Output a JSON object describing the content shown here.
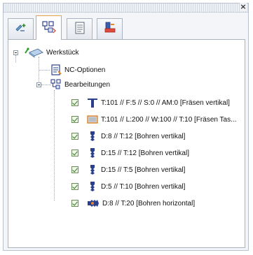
{
  "tree": {
    "root": {
      "label": "Werkstück"
    },
    "nc_options": {
      "label": "NC-Optionen"
    },
    "operations_group": {
      "label": "Bearbeitungen"
    },
    "operations": [
      {
        "label": "T:101 // F:5 // S:0 // AM:0 [Fräsen vertikal]",
        "icon": "milling-tool-icon"
      },
      {
        "label": "T:101 // L:200 // W:100 // T:10 [Fräsen Tas...",
        "icon": "pocket-milling-icon"
      },
      {
        "label": "D:8 // T:12 [Bohren vertikal]",
        "icon": "drill-vertical-icon"
      },
      {
        "label": "D:15 // T:12 [Bohren vertikal]",
        "icon": "drill-vertical-icon"
      },
      {
        "label": "D:15 // T:5 [Bohren vertikal]",
        "icon": "drill-vertical-icon"
      },
      {
        "label": "D:5 // T:10 [Bohren vertikal]",
        "icon": "drill-vertical-icon"
      },
      {
        "label": "D:8 // T:20 [Bohren horizontal]",
        "icon": "drill-horizontal-icon"
      }
    ]
  },
  "tabs": [
    {
      "icon": "add-tool-icon"
    },
    {
      "icon": "operations-tree-icon"
    },
    {
      "icon": "properties-list-icon"
    },
    {
      "icon": "tool-settings-icon"
    }
  ],
  "colors": {
    "accent_tab": "#e8a24a",
    "tool_blue": "#2b3f8f",
    "check_green": "#2f7a1f"
  }
}
